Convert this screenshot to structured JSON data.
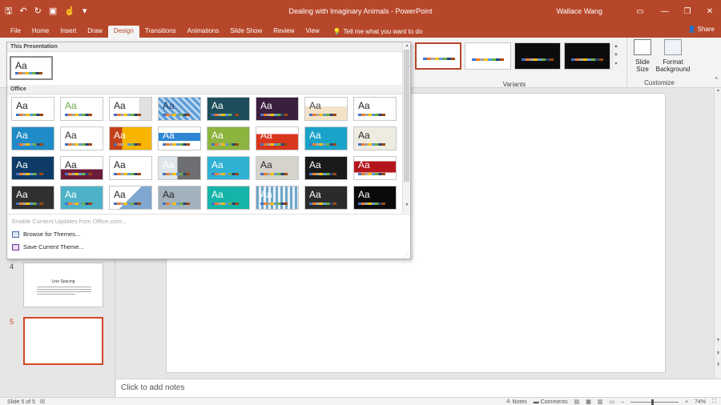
{
  "app": {
    "title": "Dealing with Imaginary Animals - PowerPoint",
    "user": "Wallace Wang",
    "accent": "#b7472a"
  },
  "qat": {
    "save_icon": "save-icon",
    "undo_icon": "undo-icon",
    "redo_icon": "redo-icon",
    "present_icon": "present-icon",
    "customize_icon": "customize-qat-icon"
  },
  "tabs": [
    {
      "label": "File"
    },
    {
      "label": "Home"
    },
    {
      "label": "Insert"
    },
    {
      "label": "Draw"
    },
    {
      "label": "Design",
      "active": true
    },
    {
      "label": "Transitions"
    },
    {
      "label": "Animations"
    },
    {
      "label": "Slide Show"
    },
    {
      "label": "Review"
    },
    {
      "label": "View"
    }
  ],
  "tell_me": "Tell me what you want to do",
  "share": "Share",
  "ribbon": {
    "variants_label": "Variants",
    "customize_label": "Customize",
    "slide_size": "Slide Size",
    "slide_size_2": "Size",
    "format_background": "Format",
    "format_background_2": "Background"
  },
  "gallery": {
    "section_this": "This Presentation",
    "section_office": "Office",
    "current_theme_text": "Aa",
    "theme_text": "Aa",
    "menu": {
      "enable_updates": "Enable Content Updates from Office.com...",
      "browse": "Browse for Themes...",
      "save": "Save Current Theme..."
    }
  },
  "slides": [
    {
      "number": "4",
      "title": "Line Spacing"
    },
    {
      "number": "5",
      "title": ""
    }
  ],
  "notes_placeholder": "Click to add notes",
  "status": {
    "slide_info": "Slide 5 of 5",
    "notes": "Notes",
    "comments": "Comments",
    "zoom": "74%"
  }
}
